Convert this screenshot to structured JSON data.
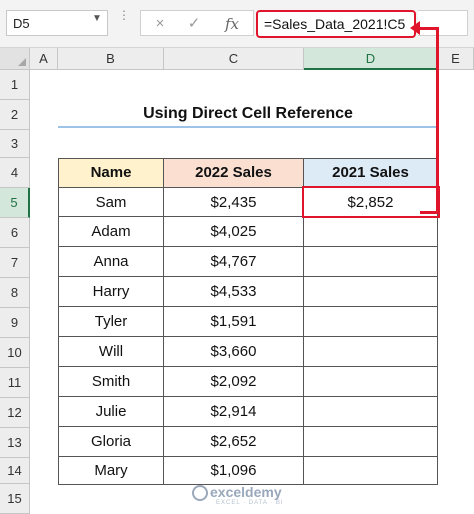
{
  "formula_bar": {
    "name_box": "D5",
    "cancel_icon": "×",
    "enter_icon": "✓",
    "fx_icon": "fx",
    "formula": "=Sales_Data_2021!C5"
  },
  "columns": [
    "A",
    "B",
    "C",
    "D",
    "E"
  ],
  "rows": [
    "1",
    "2",
    "3",
    "4",
    "5",
    "6",
    "7",
    "8",
    "9",
    "10",
    "11",
    "12",
    "13",
    "14",
    "15"
  ],
  "title": "Using Direct Cell Reference",
  "table": {
    "headers": [
      "Name",
      "2022 Sales",
      "2021 Sales"
    ],
    "rows": [
      {
        "name": "Sam",
        "sales_2022": "$2,435",
        "sales_2021": "$2,852"
      },
      {
        "name": "Adam",
        "sales_2022": "$4,025",
        "sales_2021": ""
      },
      {
        "name": "Anna",
        "sales_2022": "$4,767",
        "sales_2021": ""
      },
      {
        "name": "Harry",
        "sales_2022": "$4,533",
        "sales_2021": ""
      },
      {
        "name": "Tyler",
        "sales_2022": "$1,591",
        "sales_2021": ""
      },
      {
        "name": "Will",
        "sales_2022": "$3,660",
        "sales_2021": ""
      },
      {
        "name": "Smith",
        "sales_2022": "$2,092",
        "sales_2021": ""
      },
      {
        "name": "Julie",
        "sales_2022": "$2,914",
        "sales_2021": ""
      },
      {
        "name": "Gloria",
        "sales_2022": "$2,652",
        "sales_2021": ""
      },
      {
        "name": "Mary",
        "sales_2022": "$1,096",
        "sales_2021": ""
      }
    ]
  },
  "watermark": {
    "brand": "exceldemy",
    "tagline": "EXCEL · DATA · BI"
  },
  "colors": {
    "header_name_bg": "#fff2cc",
    "header_2022_bg": "#fbe0d2",
    "header_2021_bg": "#ddebf7",
    "highlight": "#e0142a",
    "title_underline": "#9dc3e6",
    "selected_header": "#d3e7da"
  }
}
